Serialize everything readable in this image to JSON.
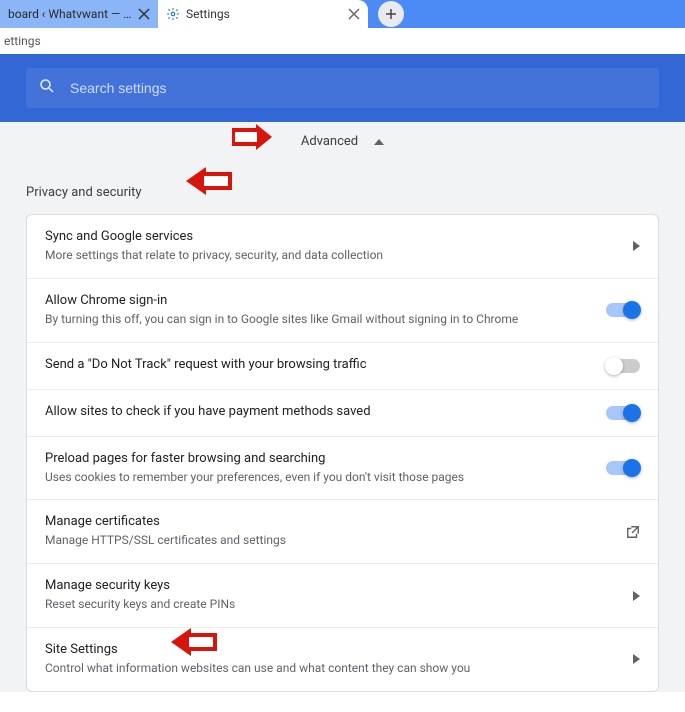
{
  "tabs": {
    "t1": {
      "title": "board ‹ Whatvwant — Word"
    },
    "t2": {
      "title": "Settings"
    }
  },
  "addressbar": {
    "text": "ettings"
  },
  "search": {
    "placeholder": "Search settings"
  },
  "advanced": {
    "label": "Advanced"
  },
  "sectionTitle": "Privacy and security",
  "rows": {
    "sync": {
      "title": "Sync and Google services",
      "sub": "More settings that relate to privacy, security, and data collection"
    },
    "signin": {
      "title": "Allow Chrome sign-in",
      "sub": "By turning this off, you can sign in to Google sites like Gmail without signing in to Chrome"
    },
    "dnt": {
      "title": "Send a \"Do Not Track\" request with your browsing traffic"
    },
    "payment": {
      "title": "Allow sites to check if you have payment methods saved"
    },
    "preload": {
      "title": "Preload pages for faster browsing and searching",
      "sub": "Uses cookies to remember your preferences, even if you don't visit those pages"
    },
    "certs": {
      "title": "Manage certificates",
      "sub": "Manage HTTPS/SSL certificates and settings"
    },
    "seckeys": {
      "title": "Manage security keys",
      "sub": "Reset security keys and create PINs"
    },
    "site": {
      "title": "Site Settings",
      "sub": "Control what information websites can use and what content they can show you"
    }
  }
}
